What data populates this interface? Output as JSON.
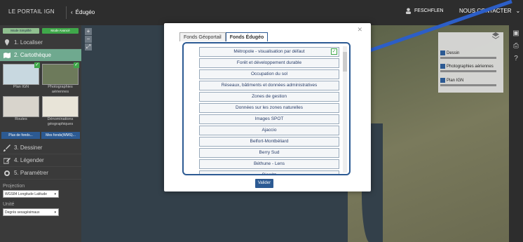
{
  "topbar": {
    "portal_title": "LE PORTAIL IGN",
    "back_label": "Édugéo",
    "user_label": "FESCHFLEN",
    "contact_label": "NOUS CONTACTER"
  },
  "leftpanel": {
    "mode_simple": "Mode Simplifié",
    "mode_advanced": "Mode Avancé",
    "sections": {
      "localiser": "1. Localiser",
      "cartotheque": "2. Cartothèque",
      "dessiner": "3. Dessiner",
      "legender": "4. Légender",
      "parametrer": "5. Paramétrer"
    },
    "thumbs": [
      "Plan IGN",
      "Photographies aériennes",
      "Routes",
      "Dénominations géographiques"
    ],
    "more_fonds": "Plus de fonds...",
    "my_fonds": "Mes fonds(WMS)...",
    "projection_label": "Projection",
    "projection_value": "WGS84 Longitude Latitude",
    "unit_label": "Unité",
    "unit_value": "Degrés sexagésimaux"
  },
  "layers": {
    "items": [
      "Dessin",
      "Photographies aériennes",
      "Plan IGN"
    ]
  },
  "modal": {
    "tabs": [
      "Fonds Géoportail",
      "Fonds Édugéo"
    ],
    "items": [
      "Métropole - visualisation par défaut",
      "Forêt et développement durable",
      "Occupation du sol",
      "Réseaux, bâtiments et données administratives",
      "Zones de gestion",
      "Données sur les zones naturelles",
      "Images SPOT",
      "Ajaccio",
      "Belfort-Montbéliard",
      "Berry Sud",
      "Béthune - Lens",
      "Biarritz"
    ],
    "validate_label": "Valider"
  },
  "colors": {
    "accent_blue": "#2c5a93",
    "green": "#3fa84a"
  }
}
